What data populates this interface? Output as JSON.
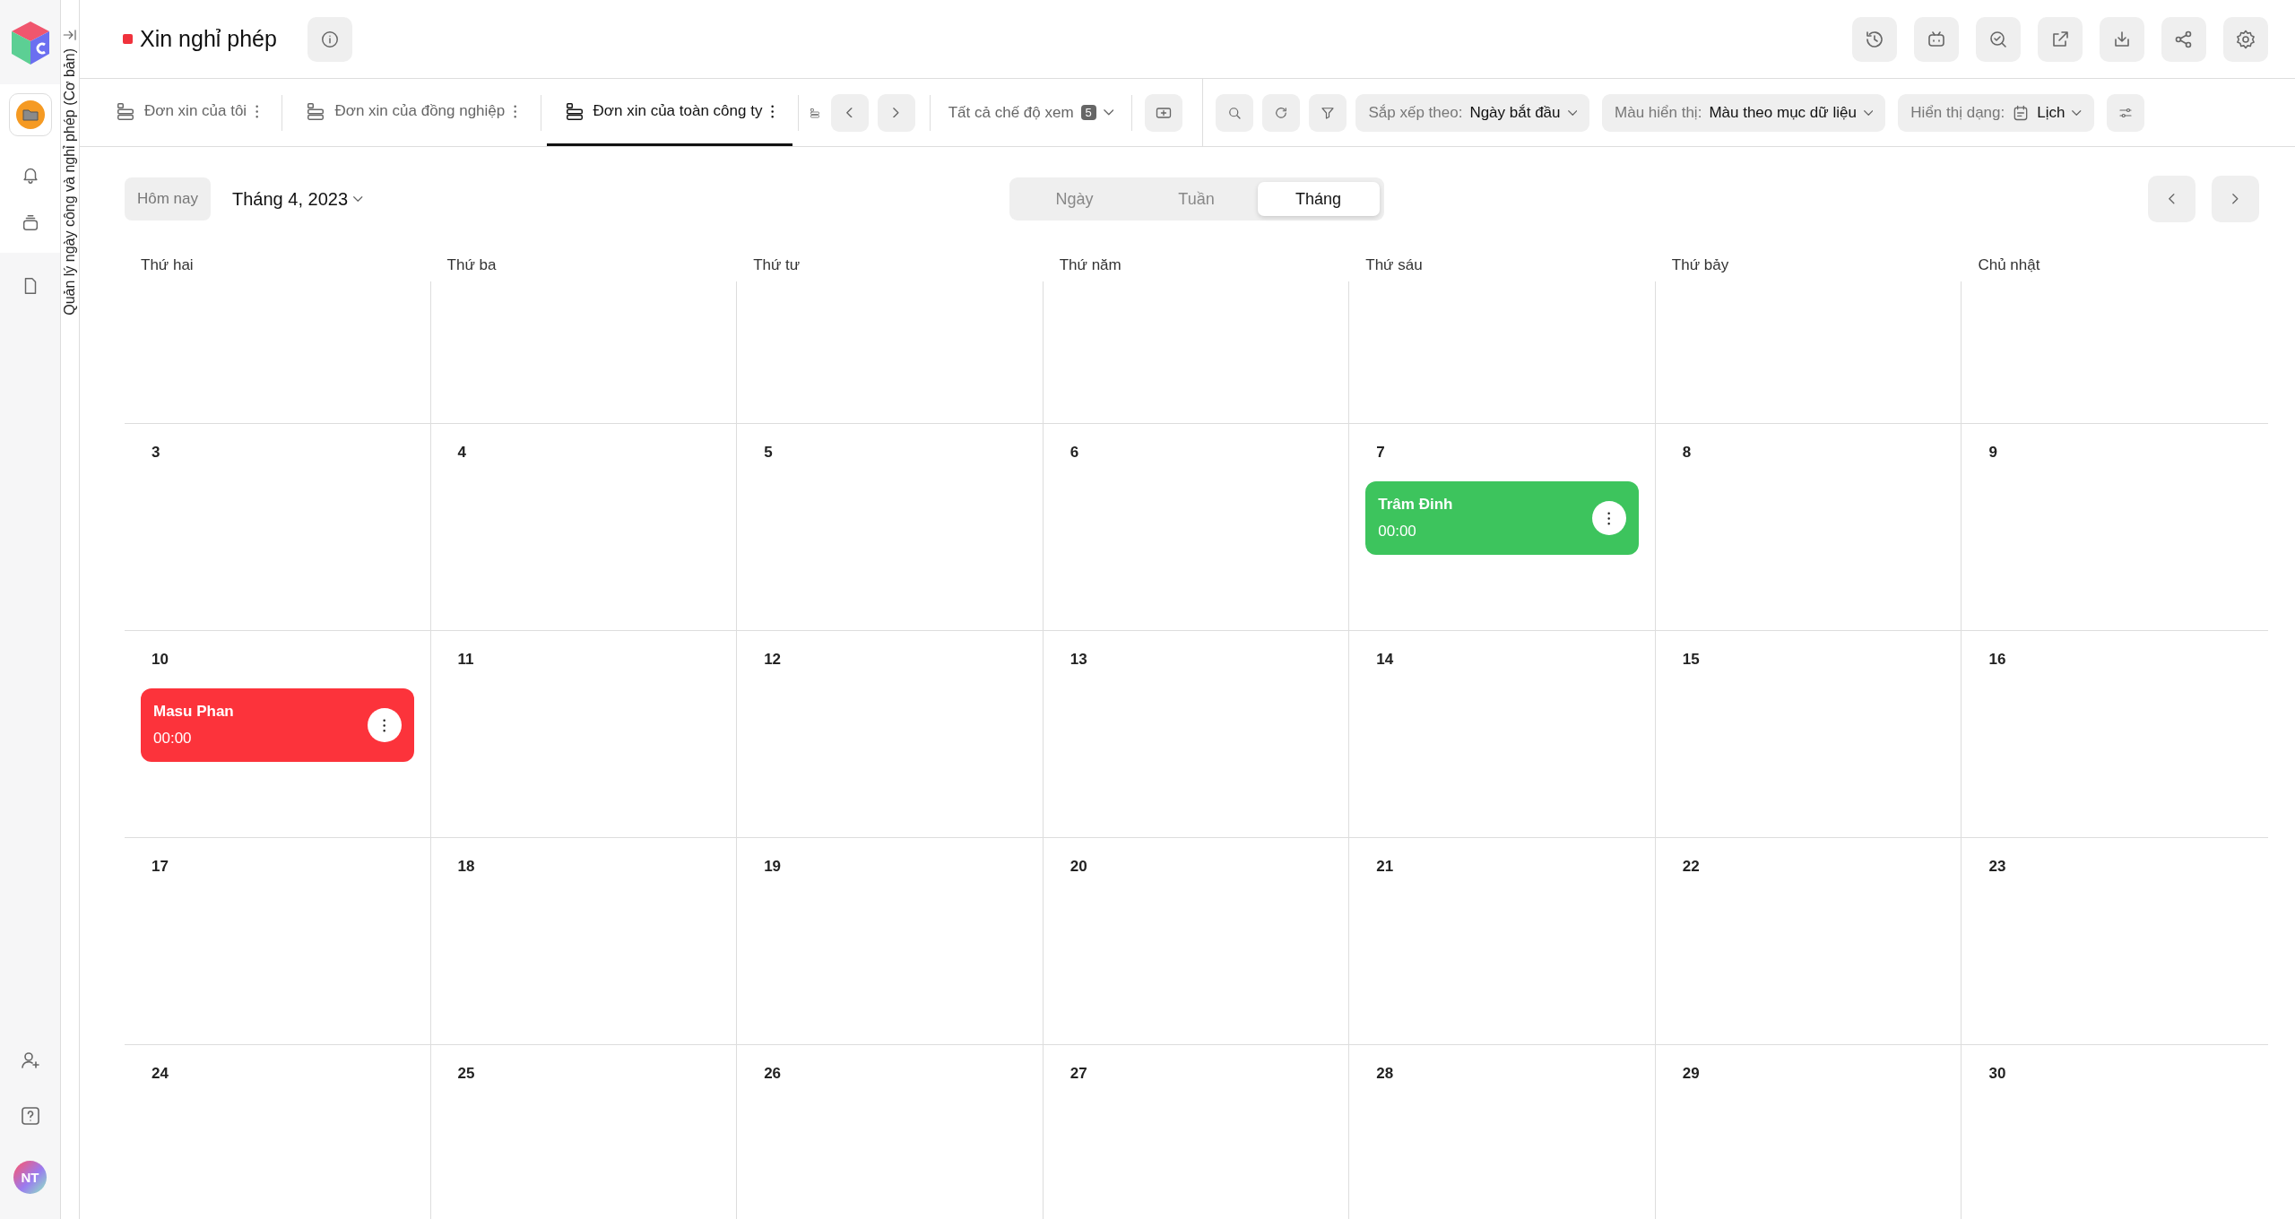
{
  "app": {
    "name": "Quản lý ngày công và nghỉ phép (Cơ bản)"
  },
  "sidebar": {
    "avatar": "NT"
  },
  "header": {
    "title": "Xin nghỉ phép"
  },
  "view_tabs": [
    {
      "label": "Đơn xin của tôi",
      "selected": false
    },
    {
      "label": "Đơn xin của đồng nghiệp",
      "selected": false
    },
    {
      "label": "Đơn xin của toàn công ty",
      "selected": true
    }
  ],
  "view_selector": {
    "label": "Tất cả chế độ xem",
    "count": "5"
  },
  "sort": {
    "label": "Sắp xếp theo:",
    "value": "Ngày bắt đầu"
  },
  "color_mode": {
    "label": "Màu hiển thị:",
    "value": "Màu theo mục dữ liệu"
  },
  "display_mode": {
    "label": "Hiển thị dạng:",
    "value": "Lịch"
  },
  "calendar": {
    "today": "Hôm nay",
    "month": "Tháng 4, 2023",
    "modes": [
      {
        "label": "Ngày",
        "selected": false
      },
      {
        "label": "Tuần",
        "selected": false
      },
      {
        "label": "Tháng",
        "selected": true
      }
    ],
    "weekdays": [
      "Thứ hai",
      "Thứ ba",
      "Thứ tư",
      "Thứ năm",
      "Thứ sáu",
      "Thứ bảy",
      "Chủ nhật"
    ],
    "weeks": [
      {
        "days": [
          {
            "day": "3"
          },
          {
            "day": "4"
          },
          {
            "day": "5"
          },
          {
            "day": "6"
          },
          {
            "day": "7",
            "events": [
              {
                "name": "Trâm Đinh",
                "time": "00:00",
                "color": "#3dc45d"
              }
            ]
          },
          {
            "day": "8"
          },
          {
            "day": "9"
          }
        ]
      },
      {
        "days": [
          {
            "day": "10",
            "events": [
              {
                "name": "Masu Phan",
                "time": "00:00",
                "color": "#fc333b"
              }
            ]
          },
          {
            "day": "11"
          },
          {
            "day": "12"
          },
          {
            "day": "13"
          },
          {
            "day": "14"
          },
          {
            "day": "15"
          },
          {
            "day": "16"
          }
        ]
      },
      {
        "days": [
          {
            "day": "17"
          },
          {
            "day": "18"
          },
          {
            "day": "19"
          },
          {
            "day": "20"
          },
          {
            "day": "21"
          },
          {
            "day": "22"
          },
          {
            "day": "23"
          }
        ]
      },
      {
        "days": [
          {
            "day": "24"
          },
          {
            "day": "25"
          },
          {
            "day": "26"
          },
          {
            "day": "27"
          },
          {
            "day": "28"
          },
          {
            "day": "29"
          },
          {
            "day": "30"
          }
        ]
      }
    ]
  }
}
